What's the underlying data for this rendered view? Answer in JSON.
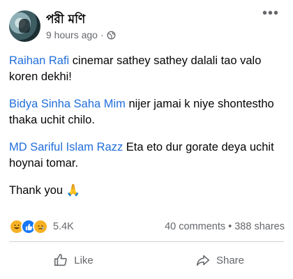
{
  "post": {
    "author": "পরী মণি",
    "time": "9 hours ago",
    "separator": "·",
    "more_label": "•••",
    "icons": {
      "privacy": "globe-icon",
      "more": "more-options-icon"
    },
    "comments": [
      {
        "mention": "Raihan Rafi",
        "text": " cinemar sathey sathey dalali tao valo koren dekhi!"
      },
      {
        "mention": "Bidya Sinha Saha Mim",
        "text": " nijer jamai k niye shontestho thaka uchit chilo."
      },
      {
        "mention": "MD Sariful Islam Razz",
        "text": " Eta eto dur gorate deya uchit hoynai tomar."
      }
    ],
    "closing": "Thank you 🙏",
    "reaction_icons": [
      "haha-icon",
      "like-icon",
      "sad-icon"
    ],
    "reaction_count": "5.4K",
    "stats": "40 comments • 388 shares",
    "actions": {
      "like": "Like",
      "share": "Share"
    },
    "colors": {
      "mention": "#216fdb",
      "muted": "#65676b",
      "like_blue": "#1877f2"
    }
  }
}
